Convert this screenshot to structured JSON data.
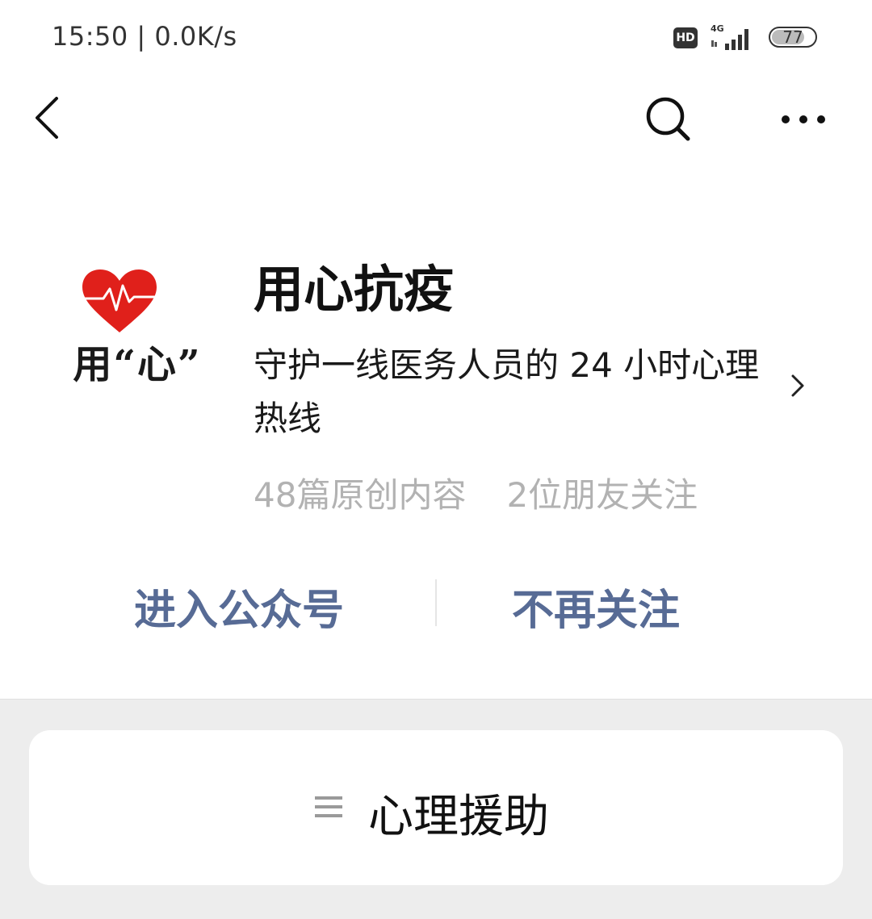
{
  "status_bar": {
    "time": "15:50 | 0.0K/s",
    "hd_badge": "HD",
    "network": "4G",
    "battery": "77",
    "battery_level": 0.77
  },
  "nav": {
    "back_icon": "chevron-left-icon",
    "search_icon": "search-icon",
    "more_icon": "more-dots-icon"
  },
  "account": {
    "logo_text": "用“心”",
    "name": "用心抗疫",
    "description": "守护一线医务人员的 24 小时心理热线",
    "original_count": "48篇原创内容",
    "friends_following": "2位朋友关注"
  },
  "actions": {
    "enter": "进入公众号",
    "unfollow": "不再关注"
  },
  "menu": {
    "items": [
      {
        "label": "心理援助",
        "icon": "menu-lines-icon"
      }
    ]
  },
  "colors": {
    "link": "#576b95",
    "heart": "#e0201b",
    "muted": "#b2b2b2",
    "bottom_bg": "#ededed"
  }
}
